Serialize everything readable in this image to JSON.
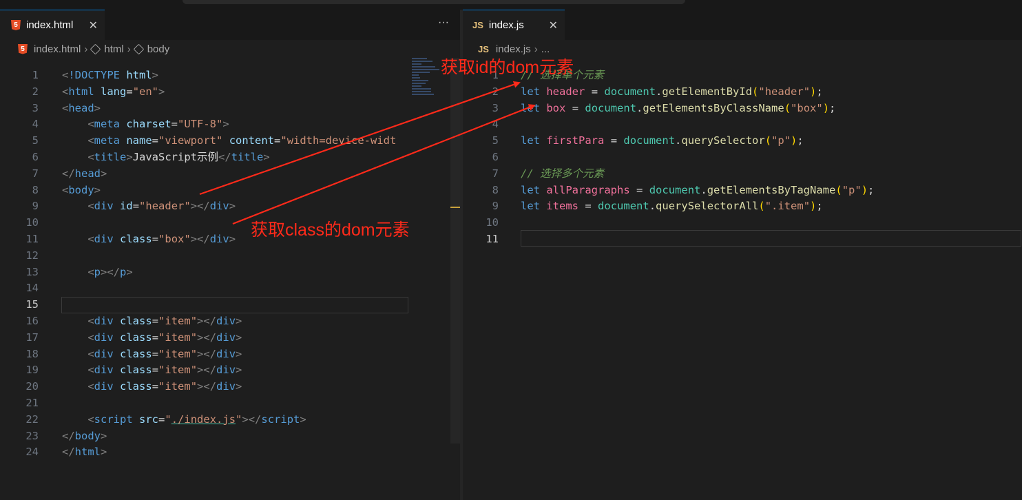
{
  "colors": {
    "accent": "#0078d4",
    "annotation": "#ff2a1a",
    "background": "#1e1e1e"
  },
  "left_editor": {
    "tab": {
      "icon": "html5-icon",
      "label": "index.html",
      "close": "✕"
    },
    "more": "···",
    "breadcrumb": [
      "index.html",
      "html",
      "body"
    ],
    "line_numbers": [
      "1",
      "2",
      "3",
      "4",
      "5",
      "6",
      "7",
      "8",
      "9",
      "10",
      "11",
      "12",
      "13",
      "14",
      "15",
      "16",
      "17",
      "18",
      "19",
      "20",
      "21",
      "22",
      "23",
      "24"
    ],
    "active_line": "15"
  },
  "right_editor": {
    "tab": {
      "icon": "js-icon",
      "icon_text": "JS",
      "label": "index.js",
      "close": "✕"
    },
    "breadcrumb": [
      "index.js",
      "..."
    ],
    "line_numbers": [
      "1",
      "2",
      "3",
      "4",
      "5",
      "6",
      "7",
      "8",
      "9",
      "10",
      "11"
    ],
    "active_line": "11",
    "comment_line1": "// 选择单个元素",
    "comment_line7": "// 选择多个元素"
  },
  "annotations": {
    "id_label": "获取id的dom元素",
    "class_label": "获取class的dom元素"
  }
}
